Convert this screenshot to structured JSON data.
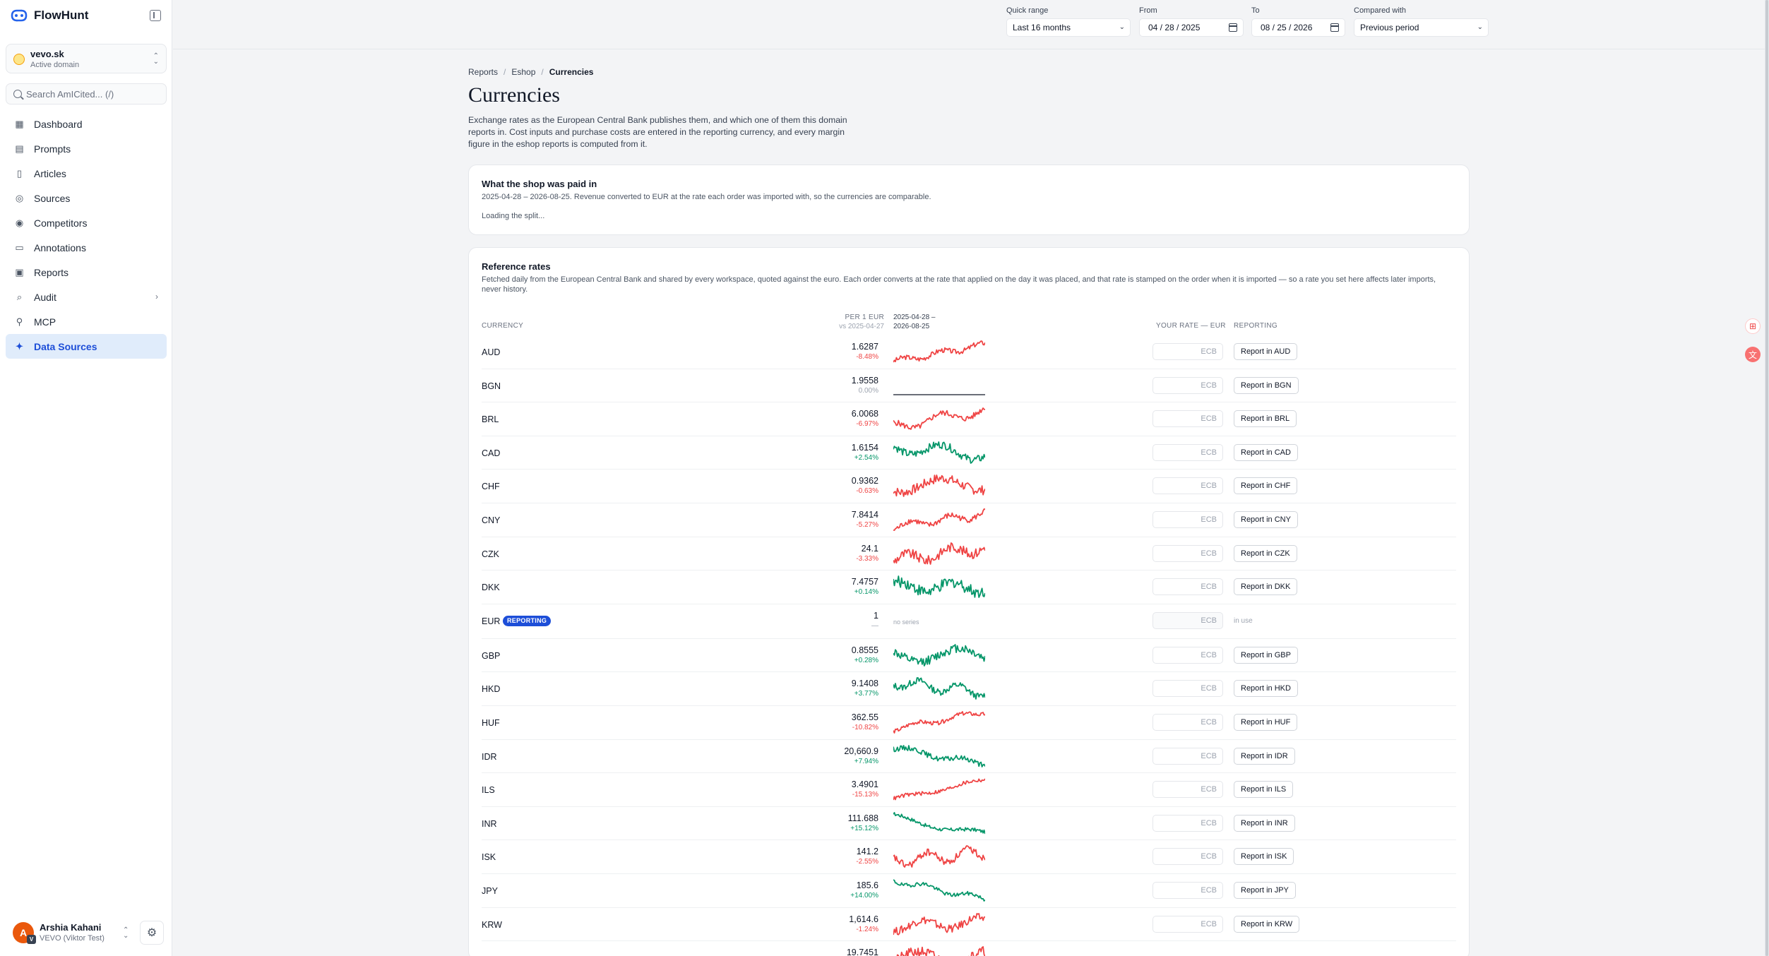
{
  "app": {
    "name": "FlowHunt"
  },
  "domain": {
    "name": "vevo.sk",
    "sub": "Active domain"
  },
  "search": {
    "placeholder": "Search AmICited... (/)"
  },
  "nav": [
    {
      "id": "dashboard",
      "label": "Dashboard",
      "icon": "dashboard-icon"
    },
    {
      "id": "prompts",
      "label": "Prompts",
      "icon": "prompts-icon"
    },
    {
      "id": "articles",
      "label": "Articles",
      "icon": "articles-icon"
    },
    {
      "id": "sources",
      "label": "Sources",
      "icon": "sources-icon"
    },
    {
      "id": "competitors",
      "label": "Competitors",
      "icon": "competitors-icon"
    },
    {
      "id": "annotations",
      "label": "Annotations",
      "icon": "annotations-icon"
    },
    {
      "id": "reports",
      "label": "Reports",
      "icon": "reports-icon"
    },
    {
      "id": "audit",
      "label": "Audit",
      "icon": "audit-icon",
      "chevron": true
    },
    {
      "id": "mcp",
      "label": "MCP",
      "icon": "mcp-icon"
    },
    {
      "id": "data-sources",
      "label": "Data Sources",
      "icon": "data-sources-icon",
      "active": true
    }
  ],
  "user": {
    "initial": "A",
    "badge": "V",
    "name": "Arshia Kahani",
    "org": "VEVO (Viktor Test)"
  },
  "filters": {
    "quick_range": {
      "label": "Quick range",
      "value": "Last 16 months"
    },
    "from": {
      "label": "From",
      "value": "04 / 28 / 2025"
    },
    "to": {
      "label": "To",
      "value": "08 / 25 / 2026"
    },
    "compared": {
      "label": "Compared with",
      "value": "Previous period"
    }
  },
  "breadcrumb": {
    "items": [
      "Reports",
      "Eshop"
    ],
    "current": "Currencies"
  },
  "page": {
    "title": "Currencies",
    "description": "Exchange rates as the European Central Bank publishes them, and which one of them this domain reports in. Cost inputs and purchase costs are entered in the reporting currency, and every margin figure in the eshop reports is computed from it."
  },
  "split_card": {
    "title": "What the shop was paid in",
    "subtitle": "2025-04-28 – 2026-08-25. Revenue converted to EUR at the rate each order was imported with, so the currencies are comparable.",
    "loading": "Loading the split..."
  },
  "rates_card": {
    "title": "Reference rates",
    "subtitle": "Fetched daily from the European Central Bank and shared by every workspace, quoted against the euro. Each order converts at the rate that applied on the day it was placed, and that rate is stamped on the order when it is imported — so a rate you set here affects later imports, never history.",
    "headers": {
      "currency": "CURRENCY",
      "per": "PER 1 EUR",
      "per_sub": "vs 2025-04-27",
      "range_line1": "2025-04-28 –",
      "range_line2": "2026-08-25",
      "your_rate": "YOUR RATE — EUR",
      "reporting": "REPORTING"
    },
    "input_placeholder": "ECB",
    "colors": {
      "up": "#059669",
      "down": "#ef4444",
      "flat": "#111827"
    },
    "rows": [
      {
        "code": "AUD",
        "rate": "1.6287",
        "change": "-8.48%",
        "dir": "down",
        "report_label": "Report in AUD"
      },
      {
        "code": "BGN",
        "rate": "1.9558",
        "change": "0.00%",
        "dir": "flat",
        "report_label": "Report in BGN"
      },
      {
        "code": "BRL",
        "rate": "6.0068",
        "change": "-6.97%",
        "dir": "down",
        "report_label": "Report in BRL"
      },
      {
        "code": "CAD",
        "rate": "1.6154",
        "change": "+2.54%",
        "dir": "up",
        "report_label": "Report in CAD"
      },
      {
        "code": "CHF",
        "rate": "0.9362",
        "change": "-0.63%",
        "dir": "down",
        "report_label": "Report in CHF"
      },
      {
        "code": "CNY",
        "rate": "7.8414",
        "change": "-5.27%",
        "dir": "down",
        "report_label": "Report in CNY"
      },
      {
        "code": "CZK",
        "rate": "24.1",
        "change": "-3.33%",
        "dir": "down",
        "report_label": "Report in CZK"
      },
      {
        "code": "DKK",
        "rate": "7.4757",
        "change": "+0.14%",
        "dir": "up",
        "report_label": "Report in DKK"
      },
      {
        "code": "EUR",
        "badge": "REPORTING",
        "rate": "1",
        "change": "—",
        "dir": "none",
        "no_series": "no series",
        "in_use": "in use"
      },
      {
        "code": "GBP",
        "rate": "0.8555",
        "change": "+0.28%",
        "dir": "up",
        "report_label": "Report in GBP"
      },
      {
        "code": "HKD",
        "rate": "9.1408",
        "change": "+3.77%",
        "dir": "up",
        "report_label": "Report in HKD"
      },
      {
        "code": "HUF",
        "rate": "362.55",
        "change": "-10.82%",
        "dir": "down",
        "report_label": "Report in HUF"
      },
      {
        "code": "IDR",
        "rate": "20,660.9",
        "change": "+7.94%",
        "dir": "up",
        "report_label": "Report in IDR"
      },
      {
        "code": "ILS",
        "rate": "3.4901",
        "change": "-15.13%",
        "dir": "down",
        "report_label": "Report in ILS"
      },
      {
        "code": "INR",
        "rate": "111.688",
        "change": "+15.12%",
        "dir": "up",
        "report_label": "Report in INR"
      },
      {
        "code": "ISK",
        "rate": "141.2",
        "change": "-2.55%",
        "dir": "down",
        "report_label": "Report in ISK"
      },
      {
        "code": "JPY",
        "rate": "185.6",
        "change": "+14.00%",
        "dir": "up",
        "report_label": "Report in JPY"
      },
      {
        "code": "KRW",
        "rate": "1,614.6",
        "change": "-1.24%",
        "dir": "down",
        "report_label": "Report in KRW"
      },
      {
        "code": "",
        "rate": "19.7451",
        "change": "",
        "dir": "down",
        "report_label": ""
      }
    ]
  }
}
